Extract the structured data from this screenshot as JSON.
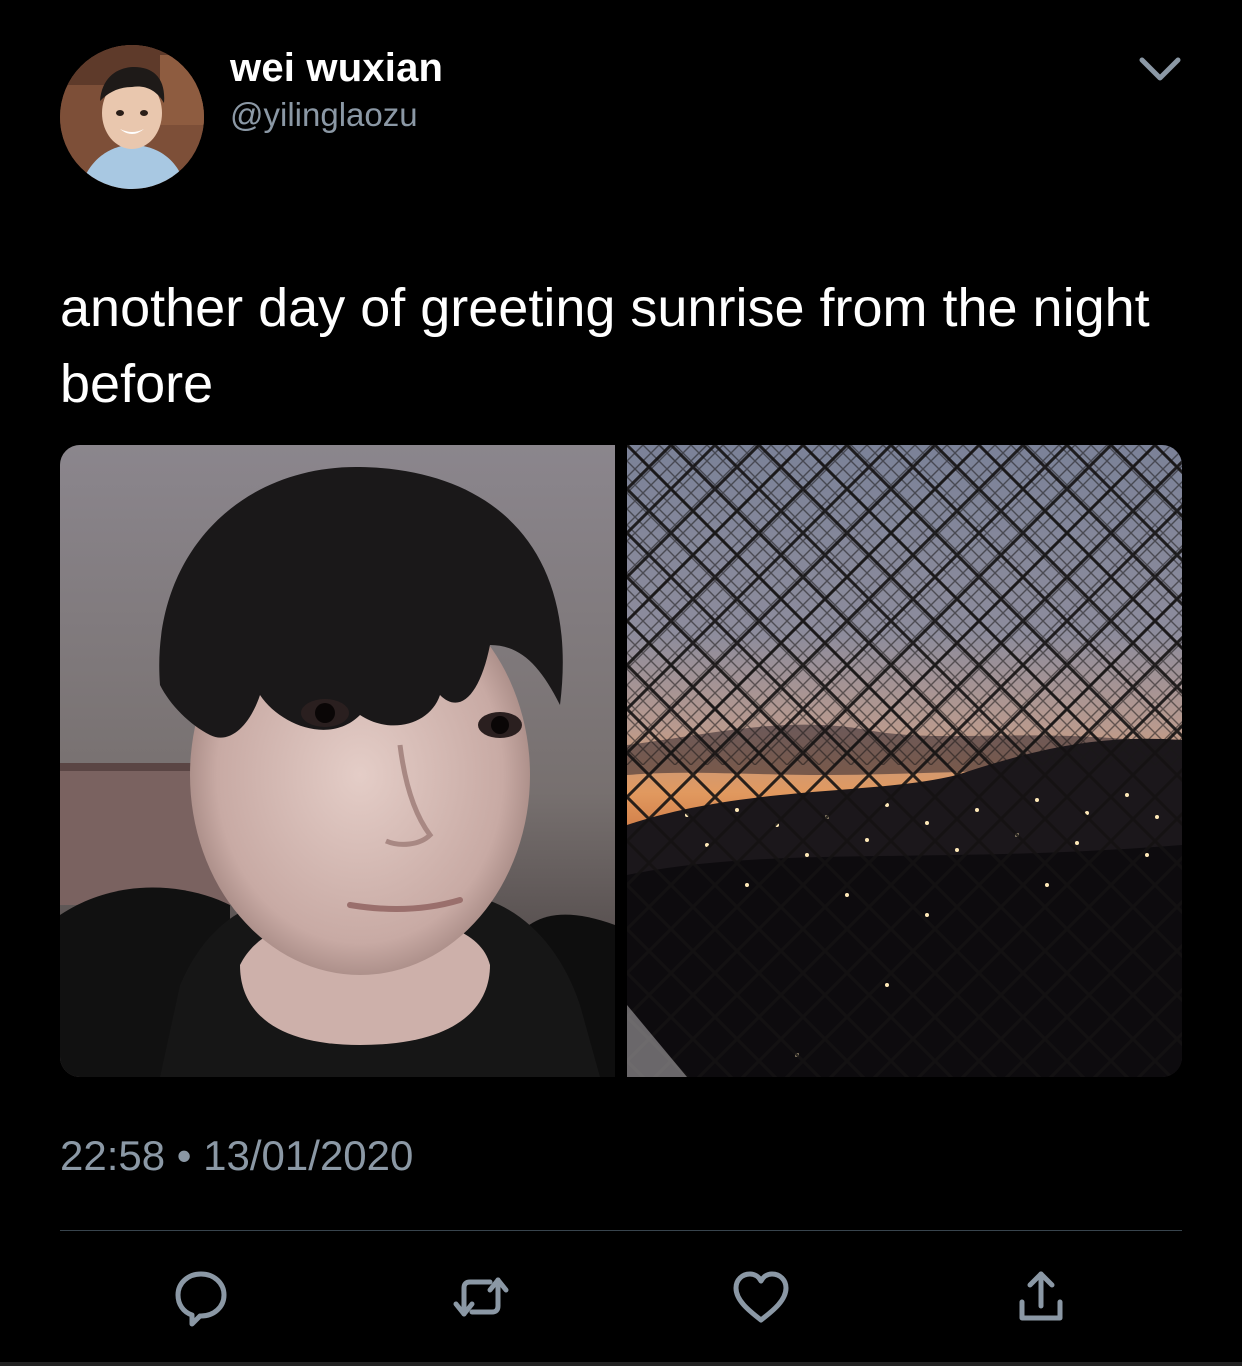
{
  "author": {
    "display_name": "wei wuxian",
    "handle": "@yilinglaozu"
  },
  "tweet": {
    "text": "another day of greeting sunrise from the night before",
    "time": "22:58",
    "separator": "•",
    "date": "13/01/2020"
  },
  "media": [
    {
      "kind": "photo",
      "subject": "selfie"
    },
    {
      "kind": "photo",
      "subject": "sunset-through-fence"
    }
  ],
  "icons": {
    "menu": "chevron-down-icon",
    "reply": "reply-icon",
    "retweet": "retweet-icon",
    "like": "heart-icon",
    "share": "share-icon"
  },
  "colors": {
    "background": "#000000",
    "text": "#ffffff",
    "secondary": "#8b98a5",
    "divider": "#38444d"
  }
}
